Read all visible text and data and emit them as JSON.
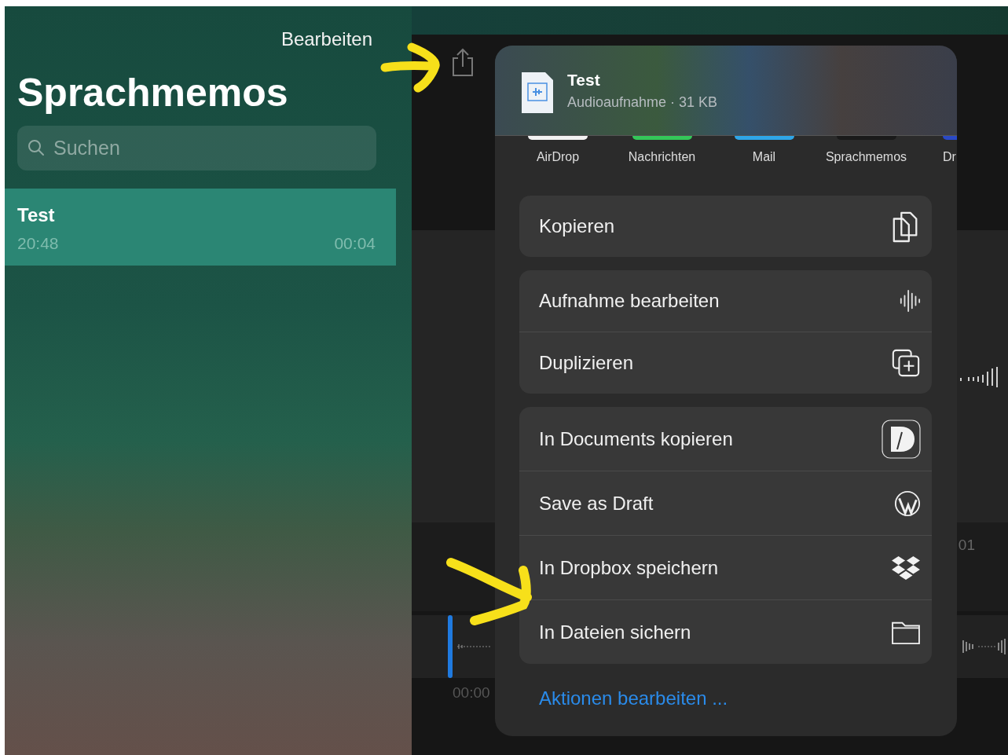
{
  "sidebar": {
    "edit_button": "Bearbeiten",
    "title": "Sprachmemos",
    "search": {
      "placeholder": "Suchen"
    },
    "recordings": [
      {
        "name": "Test",
        "time": "20:48",
        "duration": "00:04",
        "selected": true
      }
    ]
  },
  "editor": {
    "timeline_label": "01",
    "playhead_time": "00:00"
  },
  "share_sheet": {
    "file": {
      "name": "Test",
      "info": "Audioaufnahme · 31 KB"
    },
    "apps": [
      {
        "label": "AirDrop",
        "color": "#f2f2f2"
      },
      {
        "label": "Nachrichten",
        "color": "#34c759"
      },
      {
        "label": "Mail",
        "color": "#2fa6e8"
      },
      {
        "label": "Sprachmemos",
        "color": "#1a1a1a"
      },
      {
        "label": "Dr",
        "color": "#2a49c6"
      }
    ],
    "groups": [
      {
        "actions": [
          {
            "label": "Kopieren",
            "kind": "copy"
          }
        ]
      },
      {
        "actions": [
          {
            "label": "Aufnahme bearbeiten",
            "kind": "waveform"
          },
          {
            "label": "Duplizieren",
            "kind": "duplicate"
          }
        ]
      },
      {
        "actions": [
          {
            "label": "In Documents kopieren",
            "kind": "documents"
          },
          {
            "label": "Save as Draft",
            "kind": "wordpress"
          },
          {
            "label": "In Dropbox speichern",
            "kind": "dropbox"
          },
          {
            "label": "In Dateien sichern",
            "kind": "folder"
          }
        ]
      }
    ],
    "edit_actions_link": "Aktionen bearbeiten ..."
  }
}
